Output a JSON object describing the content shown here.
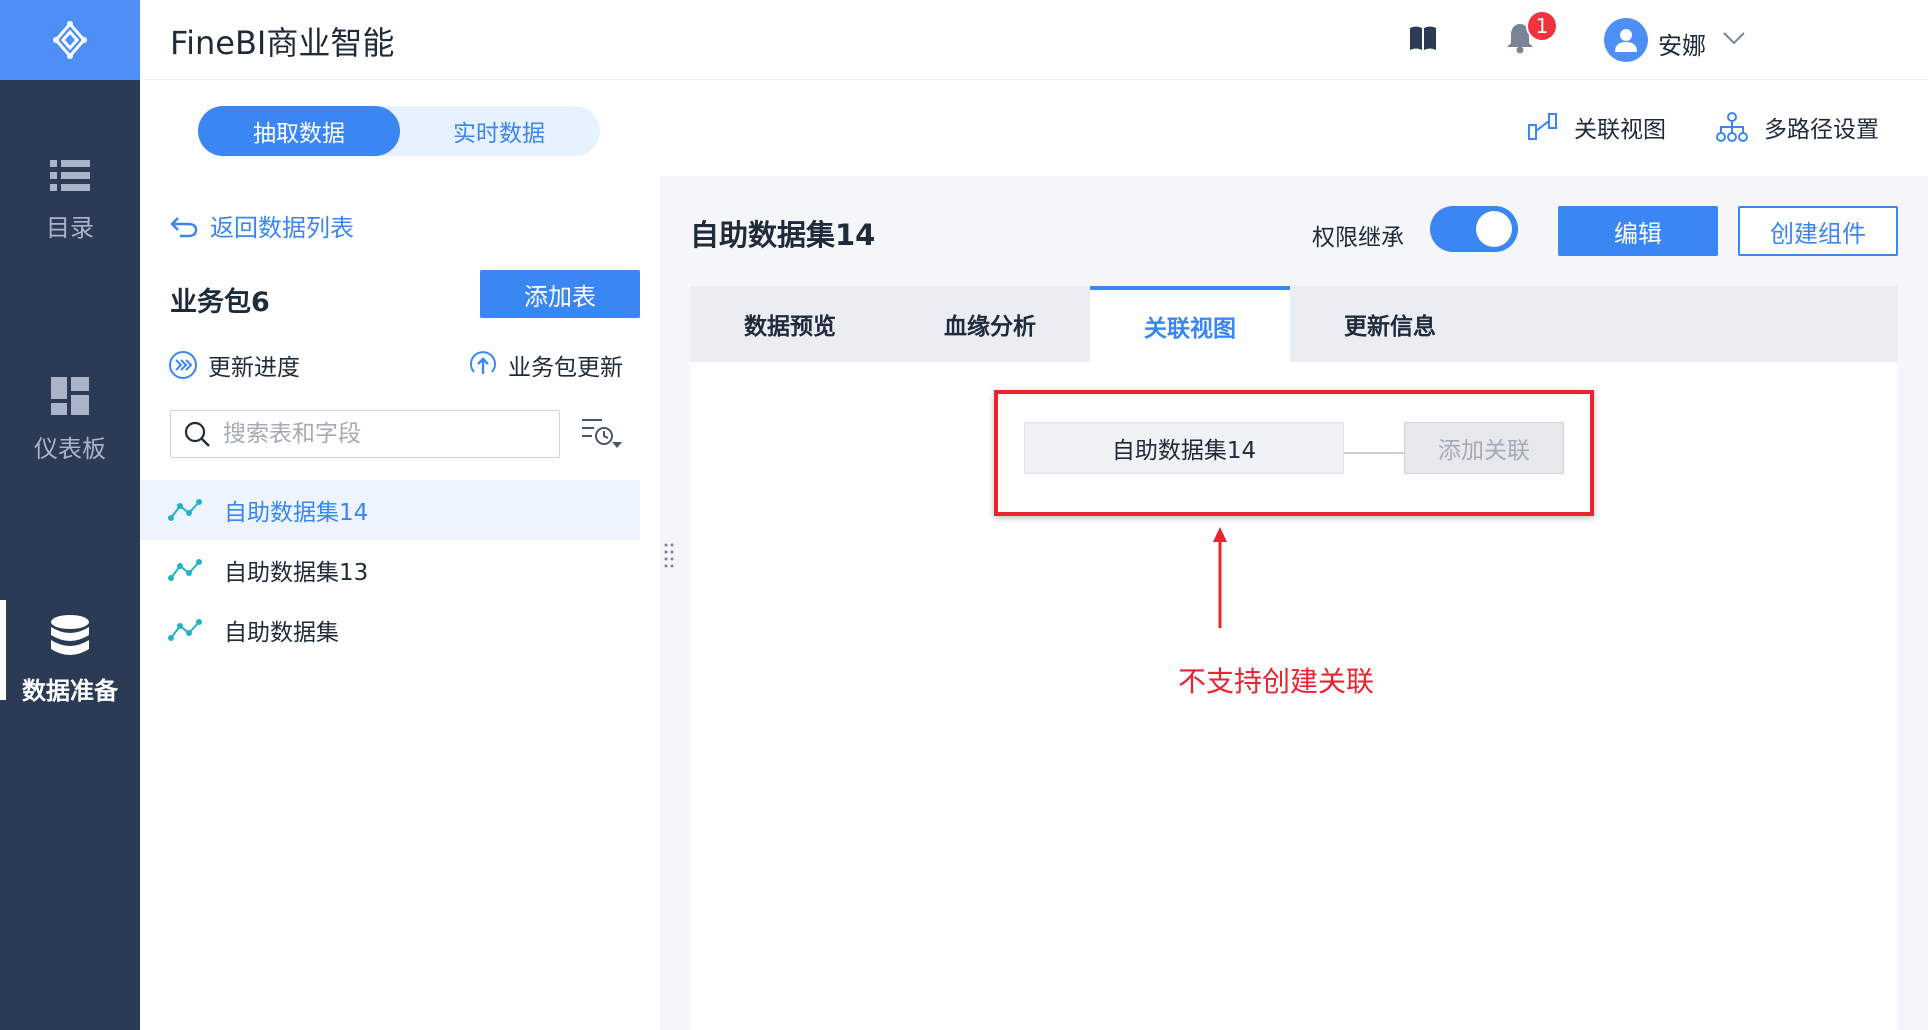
{
  "app": {
    "title": "FineBI商业智能"
  },
  "header": {
    "notification_count": "1",
    "user_name": "安娜",
    "icons": [
      "book-icon",
      "bell-icon",
      "user-icon",
      "chevron-down-icon"
    ]
  },
  "nav": {
    "items": [
      {
        "label": "目录",
        "icon": "list-icon"
      },
      {
        "label": "仪表板",
        "icon": "dashboard-icon"
      },
      {
        "label": "数据准备",
        "icon": "database-icon",
        "active": true
      }
    ]
  },
  "mode": {
    "extract": "抽取数据",
    "realtime": "实时数据",
    "selected": "抽取数据"
  },
  "top_links": {
    "relation_view": "关联视图",
    "multipath": "多路径设置"
  },
  "left_panel": {
    "back_label": "返回数据列表",
    "package_title": "业务包6",
    "add_table_label": "添加表",
    "update_progress": "更新进度",
    "package_update": "业务包更新",
    "search_placeholder": "搜索表和字段",
    "datasets": [
      {
        "name": "自助数据集14",
        "selected": true
      },
      {
        "name": "自助数据集13"
      },
      {
        "name": "自助数据集"
      }
    ]
  },
  "right_panel": {
    "title": "自助数据集14",
    "permission_label": "权限继承",
    "permission_on": true,
    "edit_label": "编辑",
    "create_component_label": "创建组件",
    "tabs": [
      {
        "label": "数据预览"
      },
      {
        "label": "血缘分析"
      },
      {
        "label": "关联视图",
        "active": true
      },
      {
        "label": "更新信息"
      }
    ],
    "relation": {
      "node_label": "自助数据集14",
      "add_label": "添加关联",
      "annotation": "不支持创建关联"
    }
  },
  "colors": {
    "nav_bg": "#2b3a55",
    "accent": "#3a86f2",
    "annotation_red": "#e8242f"
  }
}
